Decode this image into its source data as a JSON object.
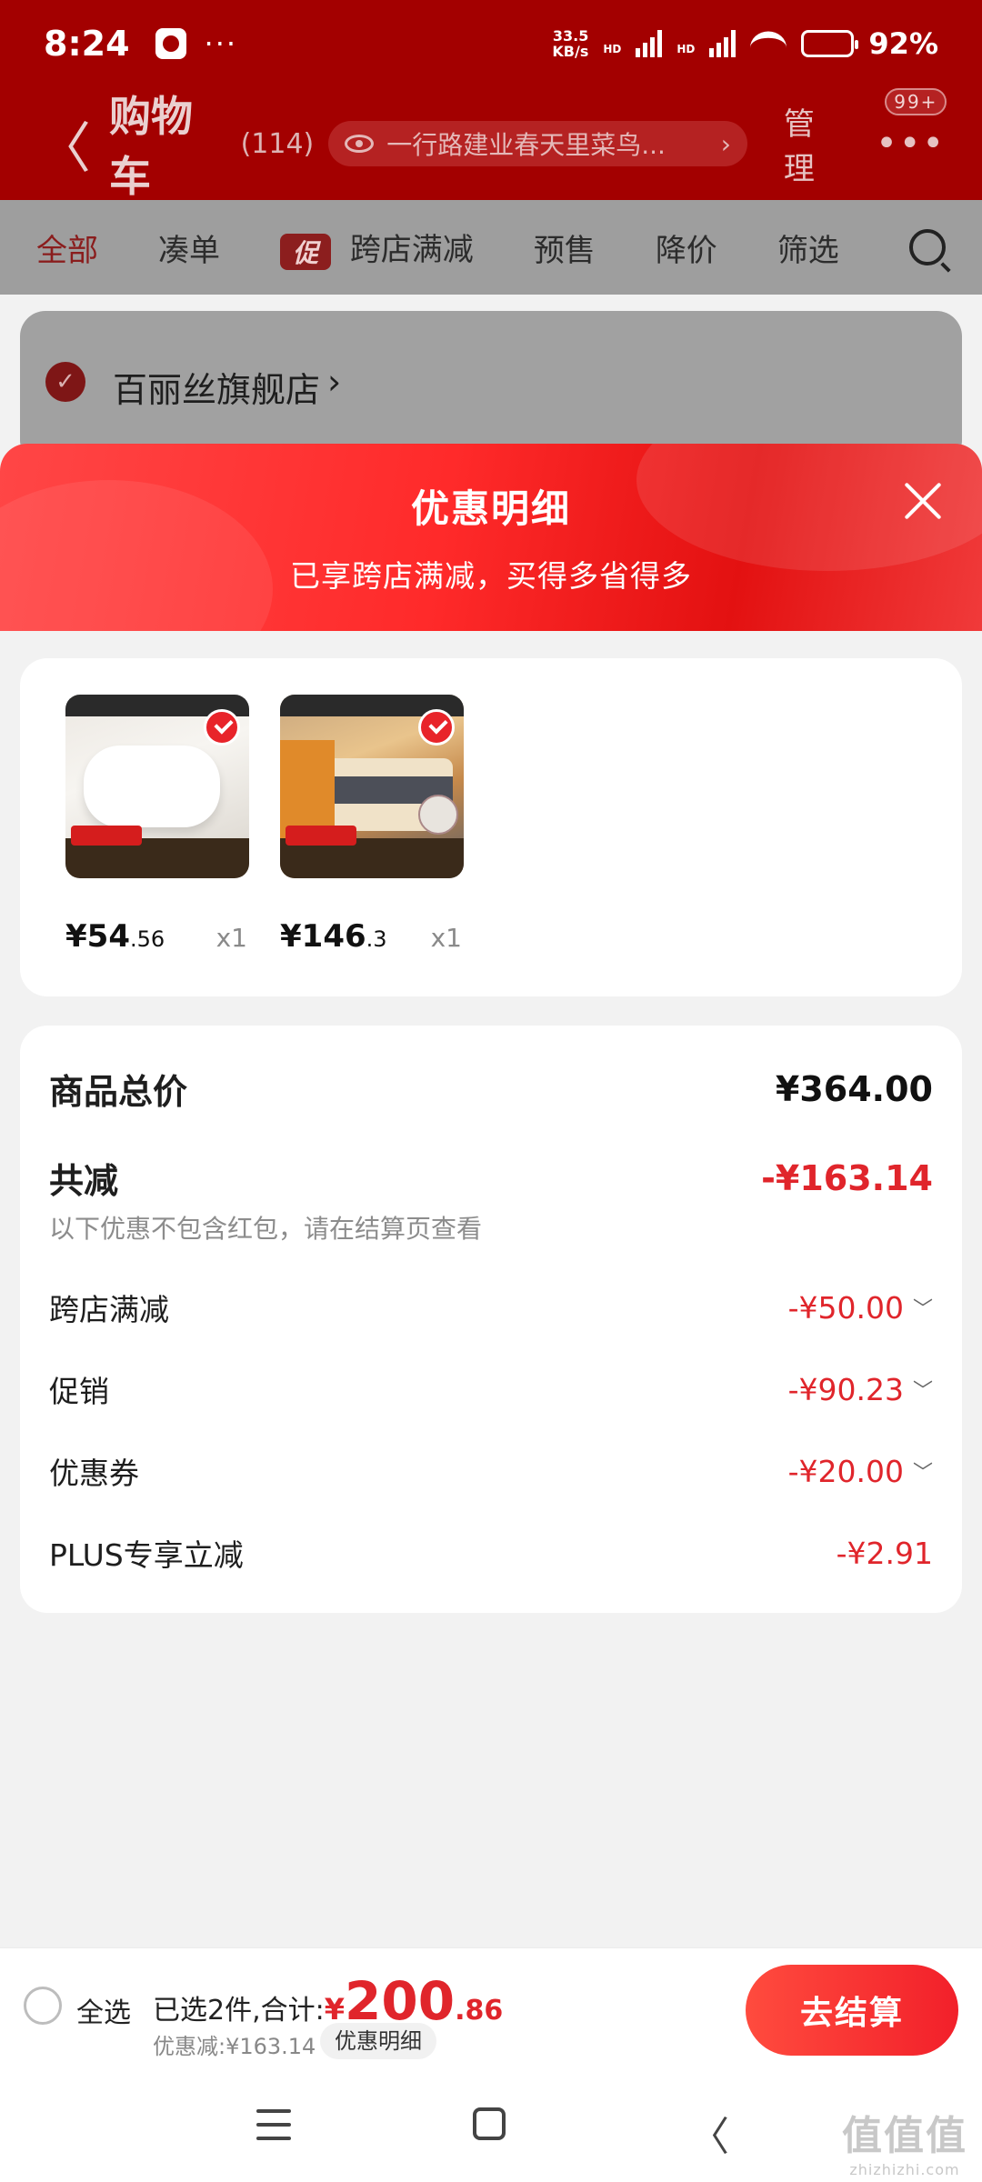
{
  "status_bar": {
    "time": "8:24",
    "more": "···",
    "net_speed_value": "33.5",
    "net_speed_unit": "KB/s",
    "hd1": "HD",
    "hd2": "HD",
    "battery_percent": "92%"
  },
  "nav": {
    "back_glyph": "〈",
    "title": "购物车",
    "count": "(114)",
    "address": "一行路建业春天里菜鸟...",
    "address_chevron": "›",
    "manage": "管理",
    "more_glyph": "•••",
    "badge": "99+"
  },
  "filters": {
    "all": "全部",
    "bundle": "凑单",
    "promo_tag": "促",
    "cross_store": "跨店满减",
    "presale": "预售",
    "price_drop": "降价",
    "filter": "筛选"
  },
  "store": {
    "check_glyph": "✓",
    "name": "百丽丝旗舰店",
    "chevron": "›"
  },
  "sheet": {
    "title": "优惠明细",
    "subtitle": "已享跨店满减，买得多省得多"
  },
  "items": [
    {
      "price_int": "¥54",
      "price_dec": ".56",
      "qty": "x1"
    },
    {
      "price_int": "¥146",
      "price_dec": ".3",
      "qty": "x1"
    }
  ],
  "summary": {
    "total_label": "商品总价",
    "total_value": "¥364.00",
    "reduced_label": "共减",
    "reduced_value": "-¥163.14",
    "note": "以下优惠不包含红包，请在结算页查看",
    "rows": [
      {
        "label": "跨店满减",
        "value": "-¥50.00",
        "caret": "﹀"
      },
      {
        "label": "促销",
        "value": "-¥90.23",
        "caret": "﹀"
      },
      {
        "label": "优惠券",
        "value": "-¥20.00",
        "caret": "﹀"
      },
      {
        "label": "PLUS专享立减",
        "value": "-¥2.91"
      }
    ]
  },
  "bottom": {
    "select_all": "全选",
    "selected_text": "已选2件,合计:",
    "currency": "¥",
    "total_int": "200",
    "total_dec": ".86",
    "discount_text": "优惠减:¥163.14",
    "detail_chip": "优惠明细",
    "checkout": "去结算"
  },
  "system_nav": {
    "back_glyph": "〈"
  },
  "watermark": {
    "mark": "值值值",
    "text": "zhizhizhi.com"
  },
  "colors": {
    "brand_red": "#e0252b",
    "header_dark_red": "#a30000",
    "sheet_gradient_start": "#ff4646",
    "sheet_gradient_end": "#e31111"
  }
}
